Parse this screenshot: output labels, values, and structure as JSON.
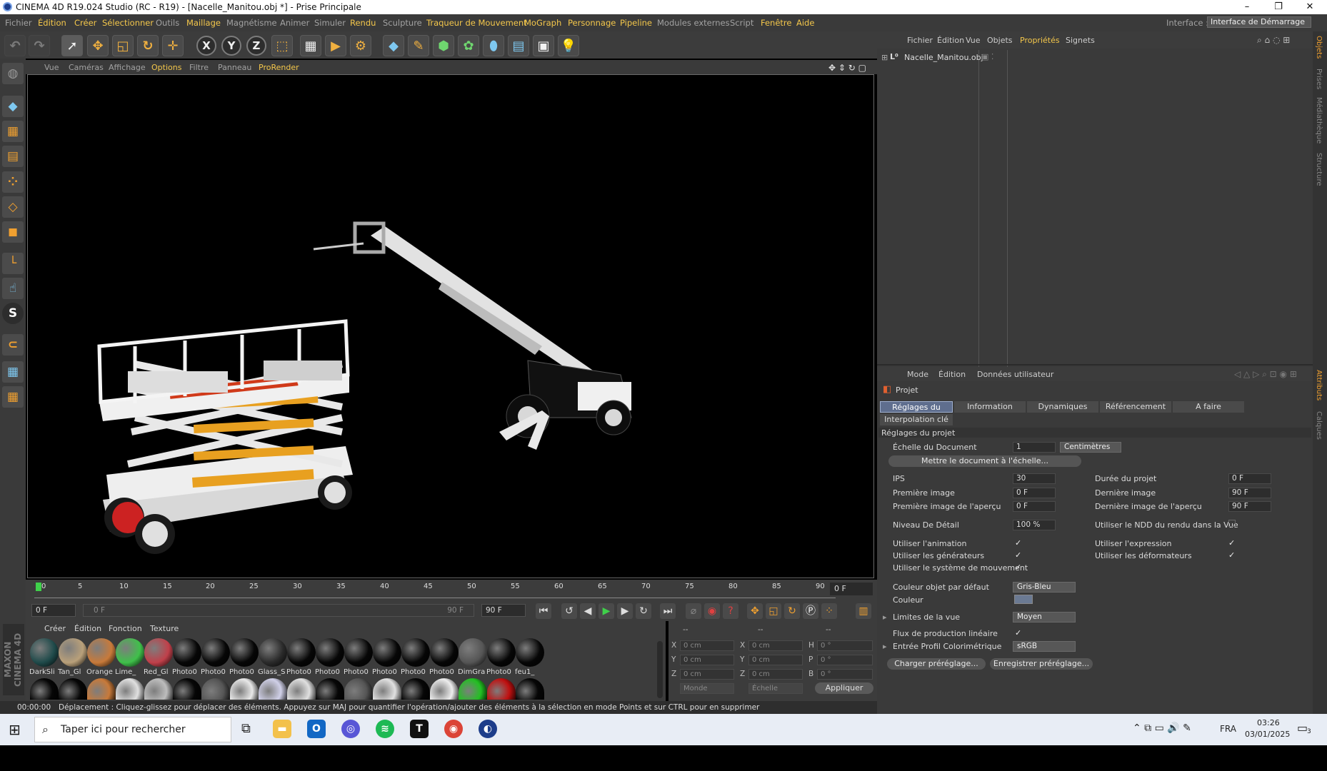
{
  "title": "CINEMA 4D R19.024 Studio (RC - R19) - [Nacelle_Manitou.obj *] - Prise Principale",
  "window_controls": {
    "minimize": "–",
    "maximize": "❐",
    "close": "✕"
  },
  "menu": [
    "Fichier",
    "Édition",
    "Créer",
    "Sélectionner",
    "Outils",
    "Maillage",
    "Magnétisme",
    "Animer",
    "Simuler",
    "Rendu",
    "Sculpture",
    "Traqueur de Mouvement",
    "MoGraph",
    "Personnage",
    "Pipeline",
    "Modules externes",
    "Script",
    "Fenêtre",
    "Aide"
  ],
  "interface": {
    "label": "Interface :",
    "value": "Interface de Démarrage"
  },
  "toolbar_axes": [
    "X",
    "Y",
    "Z"
  ],
  "viewport": {
    "menu": [
      "Vue",
      "Caméras",
      "Affichage",
      "Options",
      "Filtre",
      "Panneau",
      "ProRender"
    ]
  },
  "timeline": {
    "ticks": [
      "0",
      "5",
      "10",
      "15",
      "20",
      "25",
      "30",
      "35",
      "40",
      "45",
      "50",
      "55",
      "60",
      "65",
      "70",
      "75",
      "80",
      "85",
      "90"
    ],
    "current_end": "0 F"
  },
  "transport": {
    "start": "0 F",
    "range_start": "0 F",
    "range_end": "90 F",
    "end": "90 F"
  },
  "materials": {
    "menu": [
      "Créer",
      "Édition",
      "Fonction",
      "Texture"
    ],
    "row1": [
      {
        "label": "DarkSli",
        "color": "#1f4a4a"
      },
      {
        "label": "Tan_Gl",
        "color": "#b9a07a"
      },
      {
        "label": "Orange",
        "color": "#c87a3a"
      },
      {
        "label": "Lime_",
        "color": "#3fc04a"
      },
      {
        "label": "Red_Gl",
        "color": "#c0404a"
      },
      {
        "label": "Photo0",
        "color": "#060606"
      },
      {
        "label": "Photo0",
        "color": "#060606"
      },
      {
        "label": "Photo0",
        "color": "#060606"
      },
      {
        "label": "Glass_S",
        "color": "#2a2a2a"
      },
      {
        "label": "Photo0",
        "color": "#060606"
      },
      {
        "label": "Photo0",
        "color": "#060606"
      },
      {
        "label": "Photo0",
        "color": "#060606"
      },
      {
        "label": "Photo0",
        "color": "#060606"
      },
      {
        "label": "Photo0",
        "color": "#060606"
      },
      {
        "label": "Photo0",
        "color": "#060606"
      },
      {
        "label": "DimGra",
        "color": "#555555"
      },
      {
        "label": "Photo0",
        "color": "#060606"
      },
      {
        "label": "feu1_",
        "color": "#060606"
      }
    ],
    "row2_colors": [
      "#060606",
      "#060606",
      "#c87a3a",
      "#e0e0e0",
      "#bdbdbd",
      "#060606",
      "#555555",
      "#e8e8e8",
      "#d0d0e8",
      "#e0e0e0",
      "#060606",
      "#555555",
      "#e0e0e0",
      "#060606",
      "#ededed",
      "#22c022",
      "#c01010",
      "#060606"
    ],
    "brand": "MAXON CINEMA 4D"
  },
  "coords": {
    "header": [
      "--",
      "--",
      "--"
    ],
    "rows": [
      {
        "a": "X",
        "av": "0 cm",
        "b": "X",
        "bv": "0 cm",
        "c": "H",
        "cv": "0 °"
      },
      {
        "a": "Y",
        "av": "0 cm",
        "b": "Y",
        "bv": "0 cm",
        "c": "P",
        "cv": "0 °"
      },
      {
        "a": "Z",
        "av": "0 cm",
        "b": "Z",
        "bv": "0 cm",
        "c": "B",
        "cv": "0 °"
      }
    ],
    "mode1": "Monde",
    "mode2": "Échelle",
    "apply": "Appliquer"
  },
  "status": {
    "time": "00:00:00",
    "message": "Déplacement : Cliquez-glissez pour déplacer des éléments. Appuyez sur MAJ pour quantifier l'opération/ajouter des éléments à la sélection en mode Points et sur CTRL pour en supprimer"
  },
  "objects": {
    "menu": [
      "Fichier",
      "Édition",
      "Vue",
      "Objets",
      "Propriétés",
      "Signets"
    ],
    "items": [
      "Nacelle_Manitou.obj"
    ]
  },
  "attributes": {
    "menu": [
      "Mode",
      "Édition",
      "Données utilisateur"
    ],
    "section": "Projet",
    "tabs": [
      "Réglages du projet",
      "Information",
      "Dynamiques",
      "Référencement",
      "A faire",
      "Interpolation clé"
    ],
    "group": "Réglages du projet",
    "doc_scale_label": "Échelle du Document",
    "doc_scale_value": "1",
    "doc_scale_unit": "Centimètres",
    "scale_btn": "Mettre le document à l'échelle...",
    "left": [
      {
        "label": "IPS",
        "value": "30"
      },
      {
        "label": "Première image",
        "value": "0 F"
      },
      {
        "label": "Première image de l'aperçu",
        "value": "0 F"
      },
      {
        "label": "Niveau De Détail",
        "value": "100 %"
      }
    ],
    "right": [
      {
        "label": "Durée du projet",
        "value": "0 F"
      },
      {
        "label": "Dernière image",
        "value": "90 F"
      },
      {
        "label": "Dernière image de l'aperçu",
        "value": "90 F"
      }
    ],
    "ndd_label": "Utiliser le NDD du rendu dans la Vue",
    "checks_left": [
      "Utiliser l'animation",
      "Utiliser les générateurs",
      "Utiliser le système de mouvement"
    ],
    "checks_right": [
      "Utiliser l'expression",
      "Utiliser les déformateurs"
    ],
    "check_mark": "✓",
    "default_color_label": "Couleur objet par défaut",
    "default_color_value": "Gris-Bleu",
    "color_label": "Couleur",
    "view_limits_label": "Limites de la vue",
    "view_limits_value": "Moyen",
    "linear_label": "Flux de production linéaire",
    "profile_label": "Entrée Profil Colorimétrique",
    "profile_value": "sRGB",
    "load_btn": "Charger préréglage...",
    "save_btn": "Enregistrer préréglage..."
  },
  "side_tabs": [
    "Objets",
    "Prises",
    "Médiathèque",
    "Structure",
    "Attributs",
    "Calques"
  ],
  "taskbar": {
    "search_placeholder": "Taper ici pour rechercher",
    "lang": "FRA",
    "time": "03:26",
    "date": "03/01/2025",
    "notif": "3"
  }
}
